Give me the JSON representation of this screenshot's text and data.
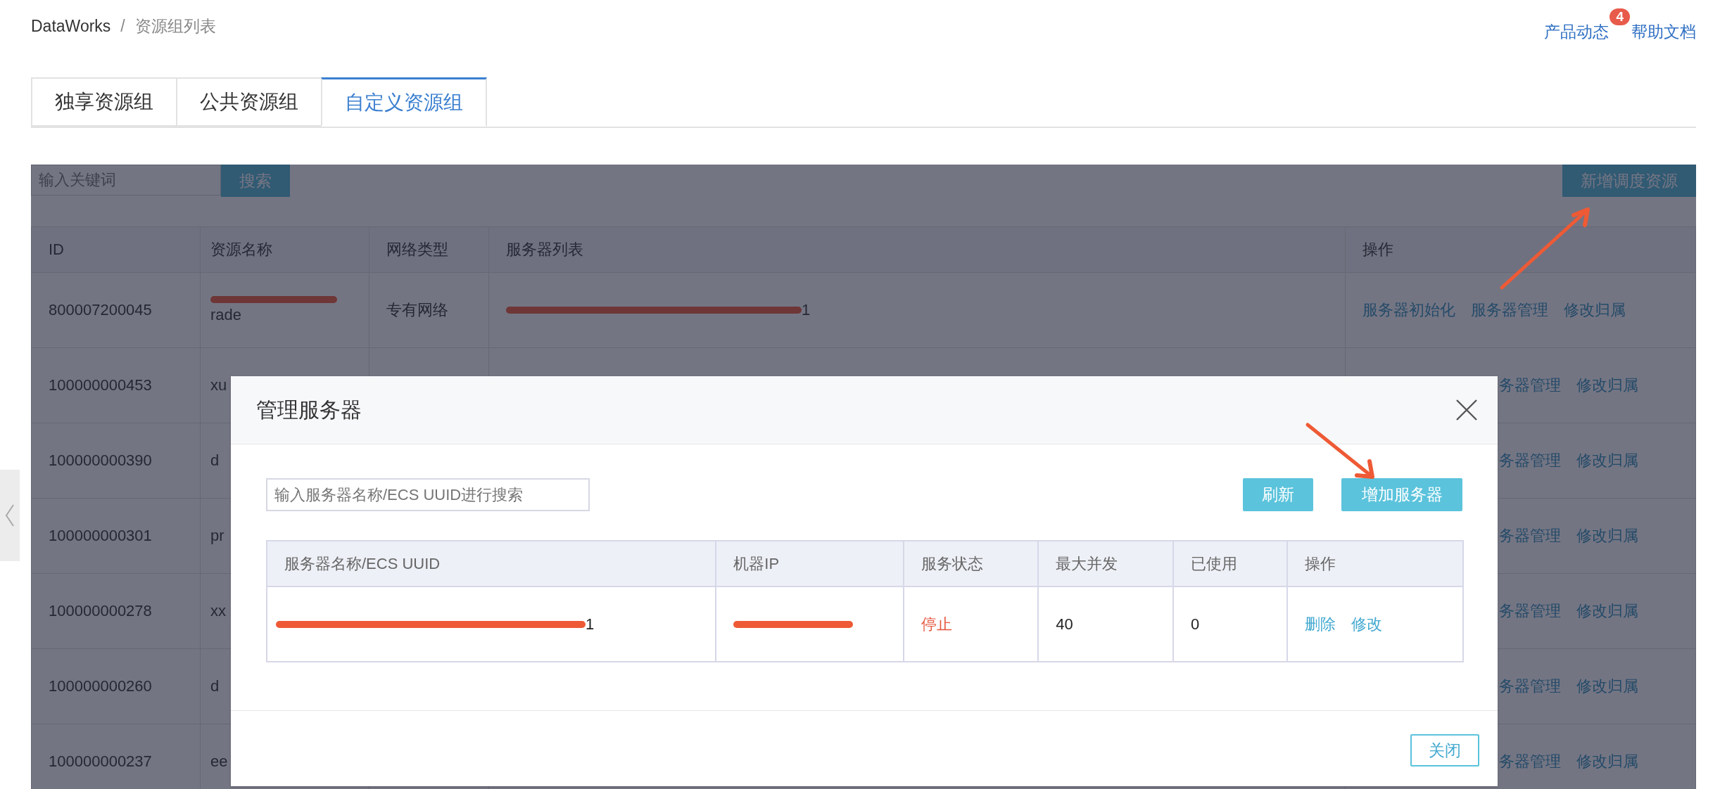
{
  "breadcrumb": {
    "items": [
      "DataWorks",
      "资源组列表"
    ],
    "separator": "/"
  },
  "header_links": [
    {
      "label": "产品动态",
      "badge": "4"
    },
    {
      "label": "帮助文档"
    }
  ],
  "tabs": [
    {
      "label": "独享资源组",
      "selected": false
    },
    {
      "label": "公共资源组",
      "selected": false
    },
    {
      "label": "自定义资源组",
      "selected": true
    }
  ],
  "toolbar": {
    "search": {
      "placeholder": "输入关键词"
    },
    "search_button": "搜索",
    "add_button": "新增调度资源"
  },
  "table": {
    "columns": [
      "ID",
      "资源名称",
      "网络类型",
      "服务器列表",
      "操作"
    ],
    "rows": [
      {
        "id": "800007200045",
        "name": {
          "text": "rade",
          "redacted": true
        },
        "network": "专有网络",
        "servers": {
          "text": "1",
          "redacted": true
        },
        "actions": [
          "服务器初始化",
          "服务器管理",
          "修改归属"
        ]
      },
      {
        "id": "100000000453",
        "name": {
          "text": "xu"
        },
        "actions": [
          "务器管理",
          "修改归属"
        ]
      },
      {
        "id": "100000000390",
        "name": {
          "text": "d"
        },
        "actions": [
          "务器管理",
          "修改归属"
        ]
      },
      {
        "id": "100000000301",
        "name": {
          "text": "pr"
        },
        "actions": [
          "务器管理",
          "修改归属"
        ]
      },
      {
        "id": "100000000278",
        "name": {
          "text": "xx"
        },
        "actions": [
          "务器管理",
          "修改归属"
        ]
      },
      {
        "id": "100000000260",
        "name": {
          "text": "d"
        },
        "actions": [
          "务器管理",
          "修改归属"
        ]
      },
      {
        "id": "100000000237",
        "name": {
          "text": "ee"
        },
        "actions": [
          "务器管理",
          "修改归属"
        ]
      }
    ]
  },
  "modal": {
    "title": "管理服务器",
    "search": {
      "placeholder": "输入服务器名称/ECS UUID进行搜索"
    },
    "buttons": [
      "刷新",
      "增加服务器"
    ],
    "table": {
      "columns": [
        "服务器名称/ECS UUID",
        "机器IP",
        "服务状态",
        "最大并发",
        "已使用",
        "操作"
      ],
      "rows": [
        {
          "name": {
            "text": "1",
            "redacted": true
          },
          "ip": {
            "redacted": true
          },
          "status": {
            "text": "停止",
            "kind": "stopped"
          },
          "max_concurrency": "40",
          "used": "0",
          "actions": [
            "删除",
            "修改"
          ]
        }
      ]
    },
    "footer_button": "关闭"
  }
}
